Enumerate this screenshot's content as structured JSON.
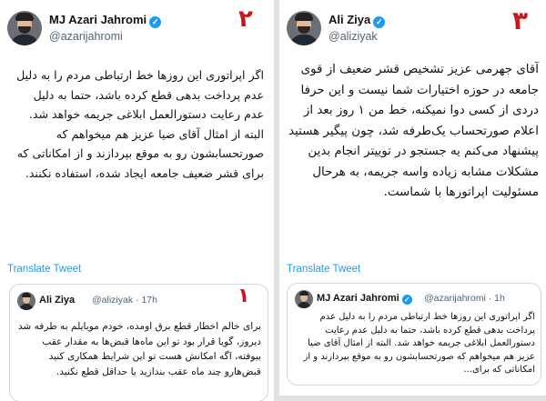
{
  "left": {
    "badge": "۲",
    "author": {
      "name": "MJ Azari Jahromi",
      "handle": "@azarijahromi"
    },
    "text": "اگر اپراتوری این روزها خط ارتباطی مردم را به دلیل عدم پرداخت بدهی قطع کرده باشد، حتما به دلیل عدم رعایت دستورالعمل ابلاغی جریمه خواهد شد. البته از امثال آقای ضیا عزیز هم میخواهم که صورتحسابشون رو به موقع بپردازند و از امکاناتی که برای قشر ضعیف جامعه ایجاد شده، استفاده نکنند.",
    "translate": "Translate Tweet",
    "quote": {
      "badge": "۱",
      "name": "Ali Ziya",
      "handle": "@aliziyak · 17h",
      "text": "برای خالم اخطار قطع برق اومده، خودم موبایلم به طرفه شد دیروز، گویا قرار بود تو این ماه‌ها قبض‌ها به مقدار عقب بیوفته، اگه امکانش هست تو این شرایط همکاری کنید قبض‌هارو چند ماه عقب بندازید یا حداقل قطع نکنید."
    }
  },
  "right": {
    "badge": "۳",
    "author": {
      "name": "Ali Ziya",
      "handle": "@aliziyak"
    },
    "text": "آقای جهرمی عزیز تشخیص قشر ضعیف از قوی جامعه در حوزه اختیارات شما نیست و این حرفا دردی از کسی دوا نمیکنه، خط من ۱ روز بعد از اعلام صورتحساب یک‌طرفه شد، چون پیگیر هستید پیشنهاد می‌کنم یه جستجو در توییتر انجام بدین مشکلات مشابه زیاده واسه جریمه، به هرحال مسئولیت اپراتورها با شماست.",
    "translate": "Translate Tweet",
    "quote": {
      "name": "MJ Azari Jahromi",
      "handle": "@azarijahromi · 1h",
      "text": "اگر اپراتوری این روزها خط ارتباطی مردم را به دلیل عدم پرداخت بدهی قطع کرده باشد، حتما به دلیل عدم رعایت دستورالعمل ابلاغی جریمه خواهد شد. البته از امثال آقای ضیا عزیز هم میخواهم که صورتحسابشون رو به موقع بپردازند و از امکاناتی که برای..."
    }
  },
  "colors": {
    "verified": "#1d9bf0",
    "badge": "#c8171e",
    "link": "#1d9bf0"
  }
}
